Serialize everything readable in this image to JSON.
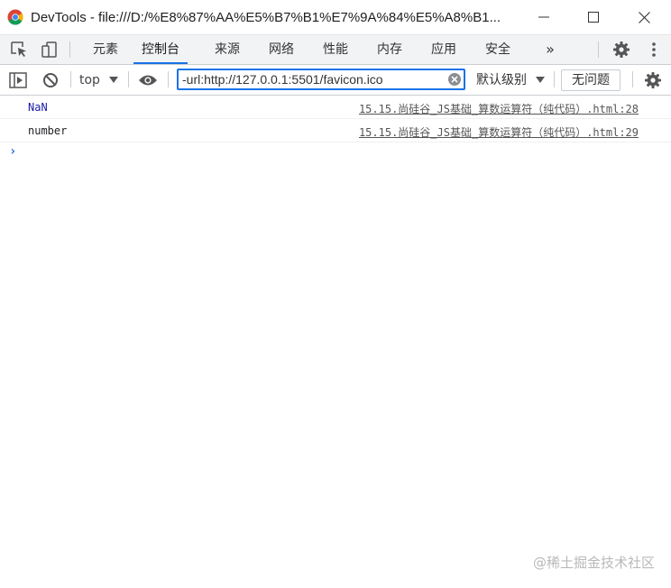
{
  "window": {
    "title": "DevTools - file:///D:/%E8%87%AA%E5%B7%B1%E7%9A%84%E5%A8%B1...",
    "minimize_icon": "minimize-icon",
    "maximize_icon": "maximize-icon",
    "close_icon": "close-icon"
  },
  "tabs": {
    "items": [
      {
        "label": "元素"
      },
      {
        "label": "控制台"
      },
      {
        "label": "来源"
      },
      {
        "label": "网络"
      },
      {
        "label": "性能"
      },
      {
        "label": "内存"
      },
      {
        "label": "应用"
      },
      {
        "label": "安全"
      }
    ],
    "active": "控制台",
    "more": "»"
  },
  "toolbar": {
    "context": "top",
    "filter_value": "-url:http://127.0.0.1:5501/favicon.ico",
    "levels": "默认级别",
    "issues": "无问题"
  },
  "console": {
    "messages": [
      {
        "value": "NaN",
        "source": "15.15.尚硅谷_JS基础_算数运算符（纯代码）.html:28"
      },
      {
        "value": "number",
        "source": "15.15.尚硅谷_JS基础_算数运算符（纯代码）.html:29"
      }
    ],
    "prompt": "›"
  },
  "watermark": "@稀土掘金技术社区",
  "colors": {
    "accent": "#1a73e8",
    "nan": "#1a1aa6"
  }
}
